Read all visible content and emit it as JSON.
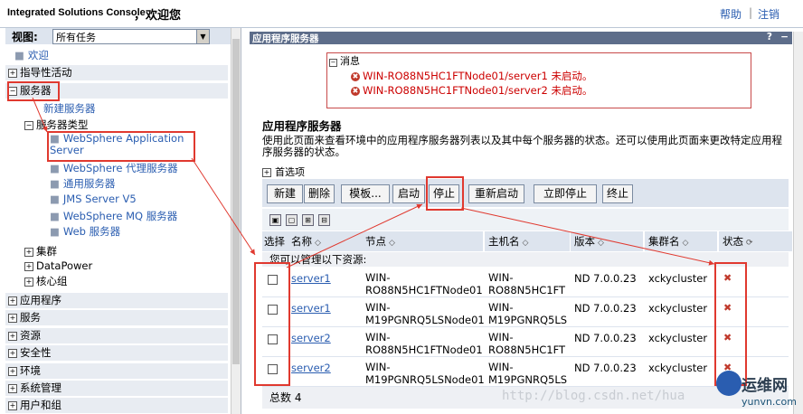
{
  "header": {
    "app_title": "Integrated Solutions Console",
    "welcome": "，欢迎您",
    "help": "帮助",
    "logout": "注销"
  },
  "nav": {
    "view_label": "视图:",
    "view_value": "所有任务",
    "welcome": "欢迎",
    "guided": "指导性活动",
    "servers": "服务器",
    "new_server": "新建服务器",
    "server_types": "服务器类型",
    "types": [
      "WebSphere Application Server",
      "WebSphere 代理服务器",
      "通用服务器",
      "JMS Server V5",
      "WebSphere MQ 服务器",
      "Web 服务器"
    ],
    "cluster": "集群",
    "datapower": "DataPower",
    "core_groups": "核心组",
    "sections": [
      "应用程序",
      "服务",
      "资源",
      "安全性",
      "环境",
      "系统管理",
      "用户和组"
    ]
  },
  "panel": {
    "title": "应用程序服务器",
    "msg_title": "消息",
    "messages": [
      "WIN-RO88N5HC1FTNode01/server1 未启动。",
      "WIN-RO88N5HC1FTNode01/server2 未启动。"
    ],
    "section_title": "应用程序服务器",
    "description": "使用此页面来查看环境中的应用程序服务器列表以及其中每个服务器的状态。还可以使用此页面来更改特定应用程序服务器的状态。",
    "prefs": "首选项",
    "buttons": [
      "新建",
      "删除",
      "模板...",
      "启动",
      "停止",
      "重新启动",
      "立即停止",
      "终止"
    ],
    "columns": [
      "选择",
      "名称",
      "节点",
      "主机名",
      "版本",
      "集群名",
      "状态"
    ],
    "manage_note": "您可以管理以下资源:",
    "rows": [
      {
        "name": "server1",
        "node1": "WIN-",
        "node2": "RO88N5HC1FTNode01",
        "host1": "WIN-",
        "host2": "RO88N5HC1FT",
        "version": "ND 7.0.0.23",
        "cluster": "xckycluster"
      },
      {
        "name": "server1",
        "node1": "WIN-",
        "node2": "M19PGNRQ5LSNode01",
        "host1": "WIN-",
        "host2": "M19PGNRQ5LS",
        "version": "ND 7.0.0.23",
        "cluster": "xckycluster"
      },
      {
        "name": "server2",
        "node1": "WIN-",
        "node2": "RO88N5HC1FTNode01",
        "host1": "WIN-",
        "host2": "RO88N5HC1FT",
        "version": "ND 7.0.0.23",
        "cluster": "xckycluster"
      },
      {
        "name": "server2",
        "node1": "WIN-",
        "node2": "M19PGNRQ5LSNode01",
        "host1": "WIN-",
        "host2": "M19PGNRQ5LS",
        "version": "ND 7.0.0.23",
        "cluster": "xckycluster"
      }
    ],
    "total": "总数 4"
  },
  "watermark": "http://blog.csdn.net/hua",
  "logo": {
    "text": "运维网",
    "sub": "yunvn.com"
  }
}
